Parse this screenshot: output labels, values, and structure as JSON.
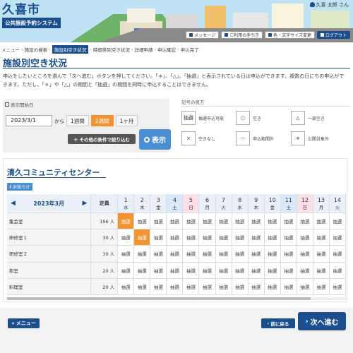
{
  "header": {
    "city": "久喜市",
    "system_name": "公共施設予約システム",
    "user": "久喜 太郎 さん",
    "buttons": [
      "メッセージ",
      "ご利用の手引き",
      "色・文字サイズ変更",
      "ログアウト"
    ]
  },
  "breadcrumb": [
    "メニュー",
    "施設の検索",
    "施設別空き状況",
    "時間帯別空き状況",
    "詳細申請",
    "申込確認",
    "申込完了"
  ],
  "page_title": "施設別空き状況",
  "intro_lines": [
    "申込をしたいところを選んで「次へ進む」ボタンを押してください。「＊」、「△」、「抽選」と表示されている日は申込ができます。複数の日にちの申込がで",
    "きます。ただし、「＊」や「△」の期間と「抽選」の期間を同時に申込することはできません。"
  ],
  "date_panel": {
    "label": "表示開始日",
    "date_value": "2023/3/1",
    "from_label": "から",
    "periods": [
      "1週間",
      "2週間",
      "1ヶ月"
    ],
    "selected_period": "2週間",
    "filter_label": "その他の条件で絞り込む",
    "show_label": "表示"
  },
  "legend": {
    "title": "記号の見方",
    "items": [
      {
        "symbol": "抽選",
        "label": "抽選申込可能"
      },
      {
        "symbol": "○",
        "label": "空き"
      },
      {
        "symbol": "△",
        "label": "一部空き"
      },
      {
        "symbol": "×",
        "label": "空きなし"
      },
      {
        "symbol": "－",
        "label": "申込期間外"
      },
      {
        "symbol": "＊",
        "label": "公開対象外"
      }
    ]
  },
  "facility": {
    "name": "清久コミュニティセンター",
    "notice_label": "お知らせ",
    "month": "2023年3月",
    "capacity_header": "定員",
    "days": [
      {
        "d": "1",
        "w": "水",
        "type": ""
      },
      {
        "d": "2",
        "w": "木",
        "type": ""
      },
      {
        "d": "3",
        "w": "金",
        "type": ""
      },
      {
        "d": "4",
        "w": "土",
        "type": "sat"
      },
      {
        "d": "5",
        "w": "日",
        "type": "sun"
      },
      {
        "d": "6",
        "w": "月",
        "type": ""
      },
      {
        "d": "7",
        "w": "火",
        "type": ""
      },
      {
        "d": "8",
        "w": "水",
        "type": ""
      },
      {
        "d": "9",
        "w": "木",
        "type": ""
      },
      {
        "d": "10",
        "w": "金",
        "type": ""
      },
      {
        "d": "11",
        "w": "土",
        "type": "sat"
      },
      {
        "d": "12",
        "w": "日",
        "type": "sun"
      },
      {
        "d": "13",
        "w": "月",
        "type": ""
      },
      {
        "d": "14",
        "w": "火",
        "type": ""
      }
    ],
    "slot_label": "抽選",
    "rooms": [
      {
        "name": "集会室",
        "capacity": "196 人",
        "selected_days": [
          0
        ]
      },
      {
        "name": "研修室１",
        "capacity": "30 人",
        "selected_days": [
          1
        ]
      },
      {
        "name": "研修室２",
        "capacity": "30 人",
        "selected_days": []
      },
      {
        "name": "和室",
        "capacity": "20 人",
        "selected_days": []
      },
      {
        "name": "料理室",
        "capacity": "20 人",
        "selected_days": []
      }
    ]
  },
  "footer": {
    "menu_label": "メニュー",
    "back_label": "前に戻る",
    "next_label": "次へ進む"
  }
}
